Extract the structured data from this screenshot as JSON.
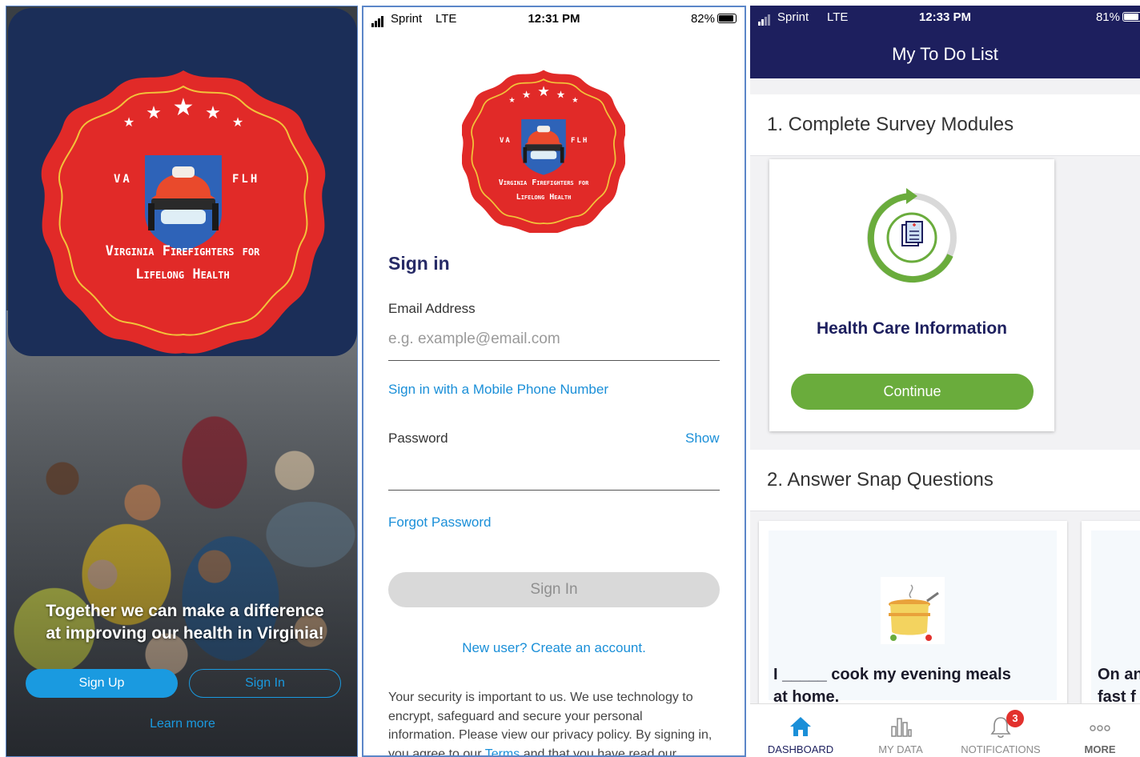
{
  "panel1": {
    "badge": {
      "left_text": "VA",
      "right_text": "FLH",
      "line1": "Virginia Firefighters for",
      "line2": "Lifelong Health"
    },
    "tagline_line1": "Together we can make a difference",
    "tagline_line2": "at improving our health in Virginia!",
    "signup_label": "Sign Up",
    "signin_label": "Sign In",
    "learn_more": "Learn more"
  },
  "panel2": {
    "status": {
      "carrier": "Sprint",
      "network": "LTE",
      "time": "12:31 PM",
      "battery": "82%"
    },
    "badge": {
      "left_text": "VA",
      "right_text": "FLH",
      "line1": "Virginia Firefighters for",
      "line2": "Lifelong Health"
    },
    "heading": "Sign in",
    "email_label": "Email Address",
    "email_placeholder": "e.g. example@email.com",
    "phone_link": "Sign in with a Mobile Phone Number",
    "password_label": "Password",
    "show_link": "Show",
    "forgot_link": "Forgot Password",
    "signin_button": "Sign In",
    "create_account": "New user? Create an account.",
    "security_text_1": "Your security is important to us. We use technology to",
    "security_text_2": "encrypt, safeguard and secure your personal",
    "security_text_3": "information. Please view our privacy policy. By signing in,",
    "security_text_4a": "you agree to our ",
    "security_terms": "Terms",
    "security_text_4b": " and that you have read our"
  },
  "panel3": {
    "status": {
      "carrier": "Sprint",
      "network": "LTE",
      "time": "12:33 PM",
      "battery": "81%"
    },
    "title": "My To Do List",
    "section1": "1. Complete Survey Modules",
    "card_title": "Health Care Information",
    "continue_label": "Continue",
    "section2": "2. Answer Snap Questions",
    "snap_q1_line1": "I _____ cook my evening meals",
    "snap_q1_line2": "at home.",
    "snap_q2_line1": "On an",
    "snap_q2_line2": "fast f",
    "tabs": [
      {
        "label": "DASHBOARD",
        "icon": "home-icon"
      },
      {
        "label": "MY DATA",
        "icon": "bar-chart-icon"
      },
      {
        "label": "NOTIFICATIONS",
        "icon": "bell-icon"
      },
      {
        "label": "MORE",
        "icon": "more-icon"
      }
    ],
    "notification_count": "3",
    "colors": {
      "header": "#1d1f5e",
      "accent": "#6aac3c",
      "tab_active": "#1a8fd8",
      "badge": "#e2312d"
    }
  }
}
